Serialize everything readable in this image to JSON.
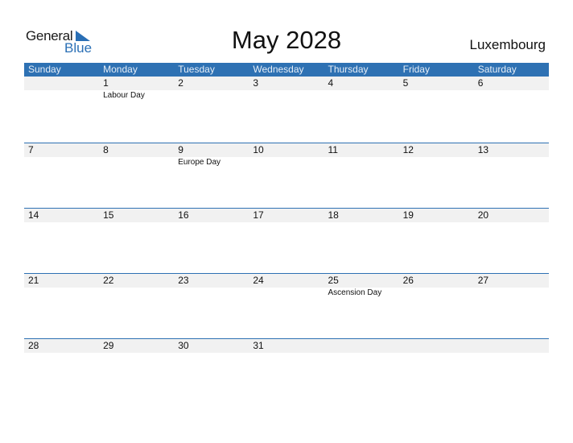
{
  "logo": {
    "general": "General",
    "blue": "Blue",
    "icon": "triangle-flag-icon"
  },
  "title": "May 2028",
  "country": "Luxembourg",
  "colors": {
    "accent": "#2e71b3",
    "band": "#f1f1f1"
  },
  "weekdays": [
    "Sunday",
    "Monday",
    "Tuesday",
    "Wednesday",
    "Thursday",
    "Friday",
    "Saturday"
  ],
  "weeks": [
    {
      "days": [
        {
          "num": "",
          "holiday": ""
        },
        {
          "num": "1",
          "holiday": "Labour Day"
        },
        {
          "num": "2",
          "holiday": ""
        },
        {
          "num": "3",
          "holiday": ""
        },
        {
          "num": "4",
          "holiday": ""
        },
        {
          "num": "5",
          "holiday": ""
        },
        {
          "num": "6",
          "holiday": ""
        }
      ]
    },
    {
      "days": [
        {
          "num": "7",
          "holiday": ""
        },
        {
          "num": "8",
          "holiday": ""
        },
        {
          "num": "9",
          "holiday": "Europe Day"
        },
        {
          "num": "10",
          "holiday": ""
        },
        {
          "num": "11",
          "holiday": ""
        },
        {
          "num": "12",
          "holiday": ""
        },
        {
          "num": "13",
          "holiday": ""
        }
      ]
    },
    {
      "days": [
        {
          "num": "14",
          "holiday": ""
        },
        {
          "num": "15",
          "holiday": ""
        },
        {
          "num": "16",
          "holiday": ""
        },
        {
          "num": "17",
          "holiday": ""
        },
        {
          "num": "18",
          "holiday": ""
        },
        {
          "num": "19",
          "holiday": ""
        },
        {
          "num": "20",
          "holiday": ""
        }
      ]
    },
    {
      "days": [
        {
          "num": "21",
          "holiday": ""
        },
        {
          "num": "22",
          "holiday": ""
        },
        {
          "num": "23",
          "holiday": ""
        },
        {
          "num": "24",
          "holiday": ""
        },
        {
          "num": "25",
          "holiday": "Ascension Day"
        },
        {
          "num": "26",
          "holiday": ""
        },
        {
          "num": "27",
          "holiday": ""
        }
      ]
    },
    {
      "days": [
        {
          "num": "28",
          "holiday": ""
        },
        {
          "num": "29",
          "holiday": ""
        },
        {
          "num": "30",
          "holiday": ""
        },
        {
          "num": "31",
          "holiday": ""
        },
        {
          "num": "",
          "holiday": ""
        },
        {
          "num": "",
          "holiday": ""
        },
        {
          "num": "",
          "holiday": ""
        }
      ]
    }
  ]
}
